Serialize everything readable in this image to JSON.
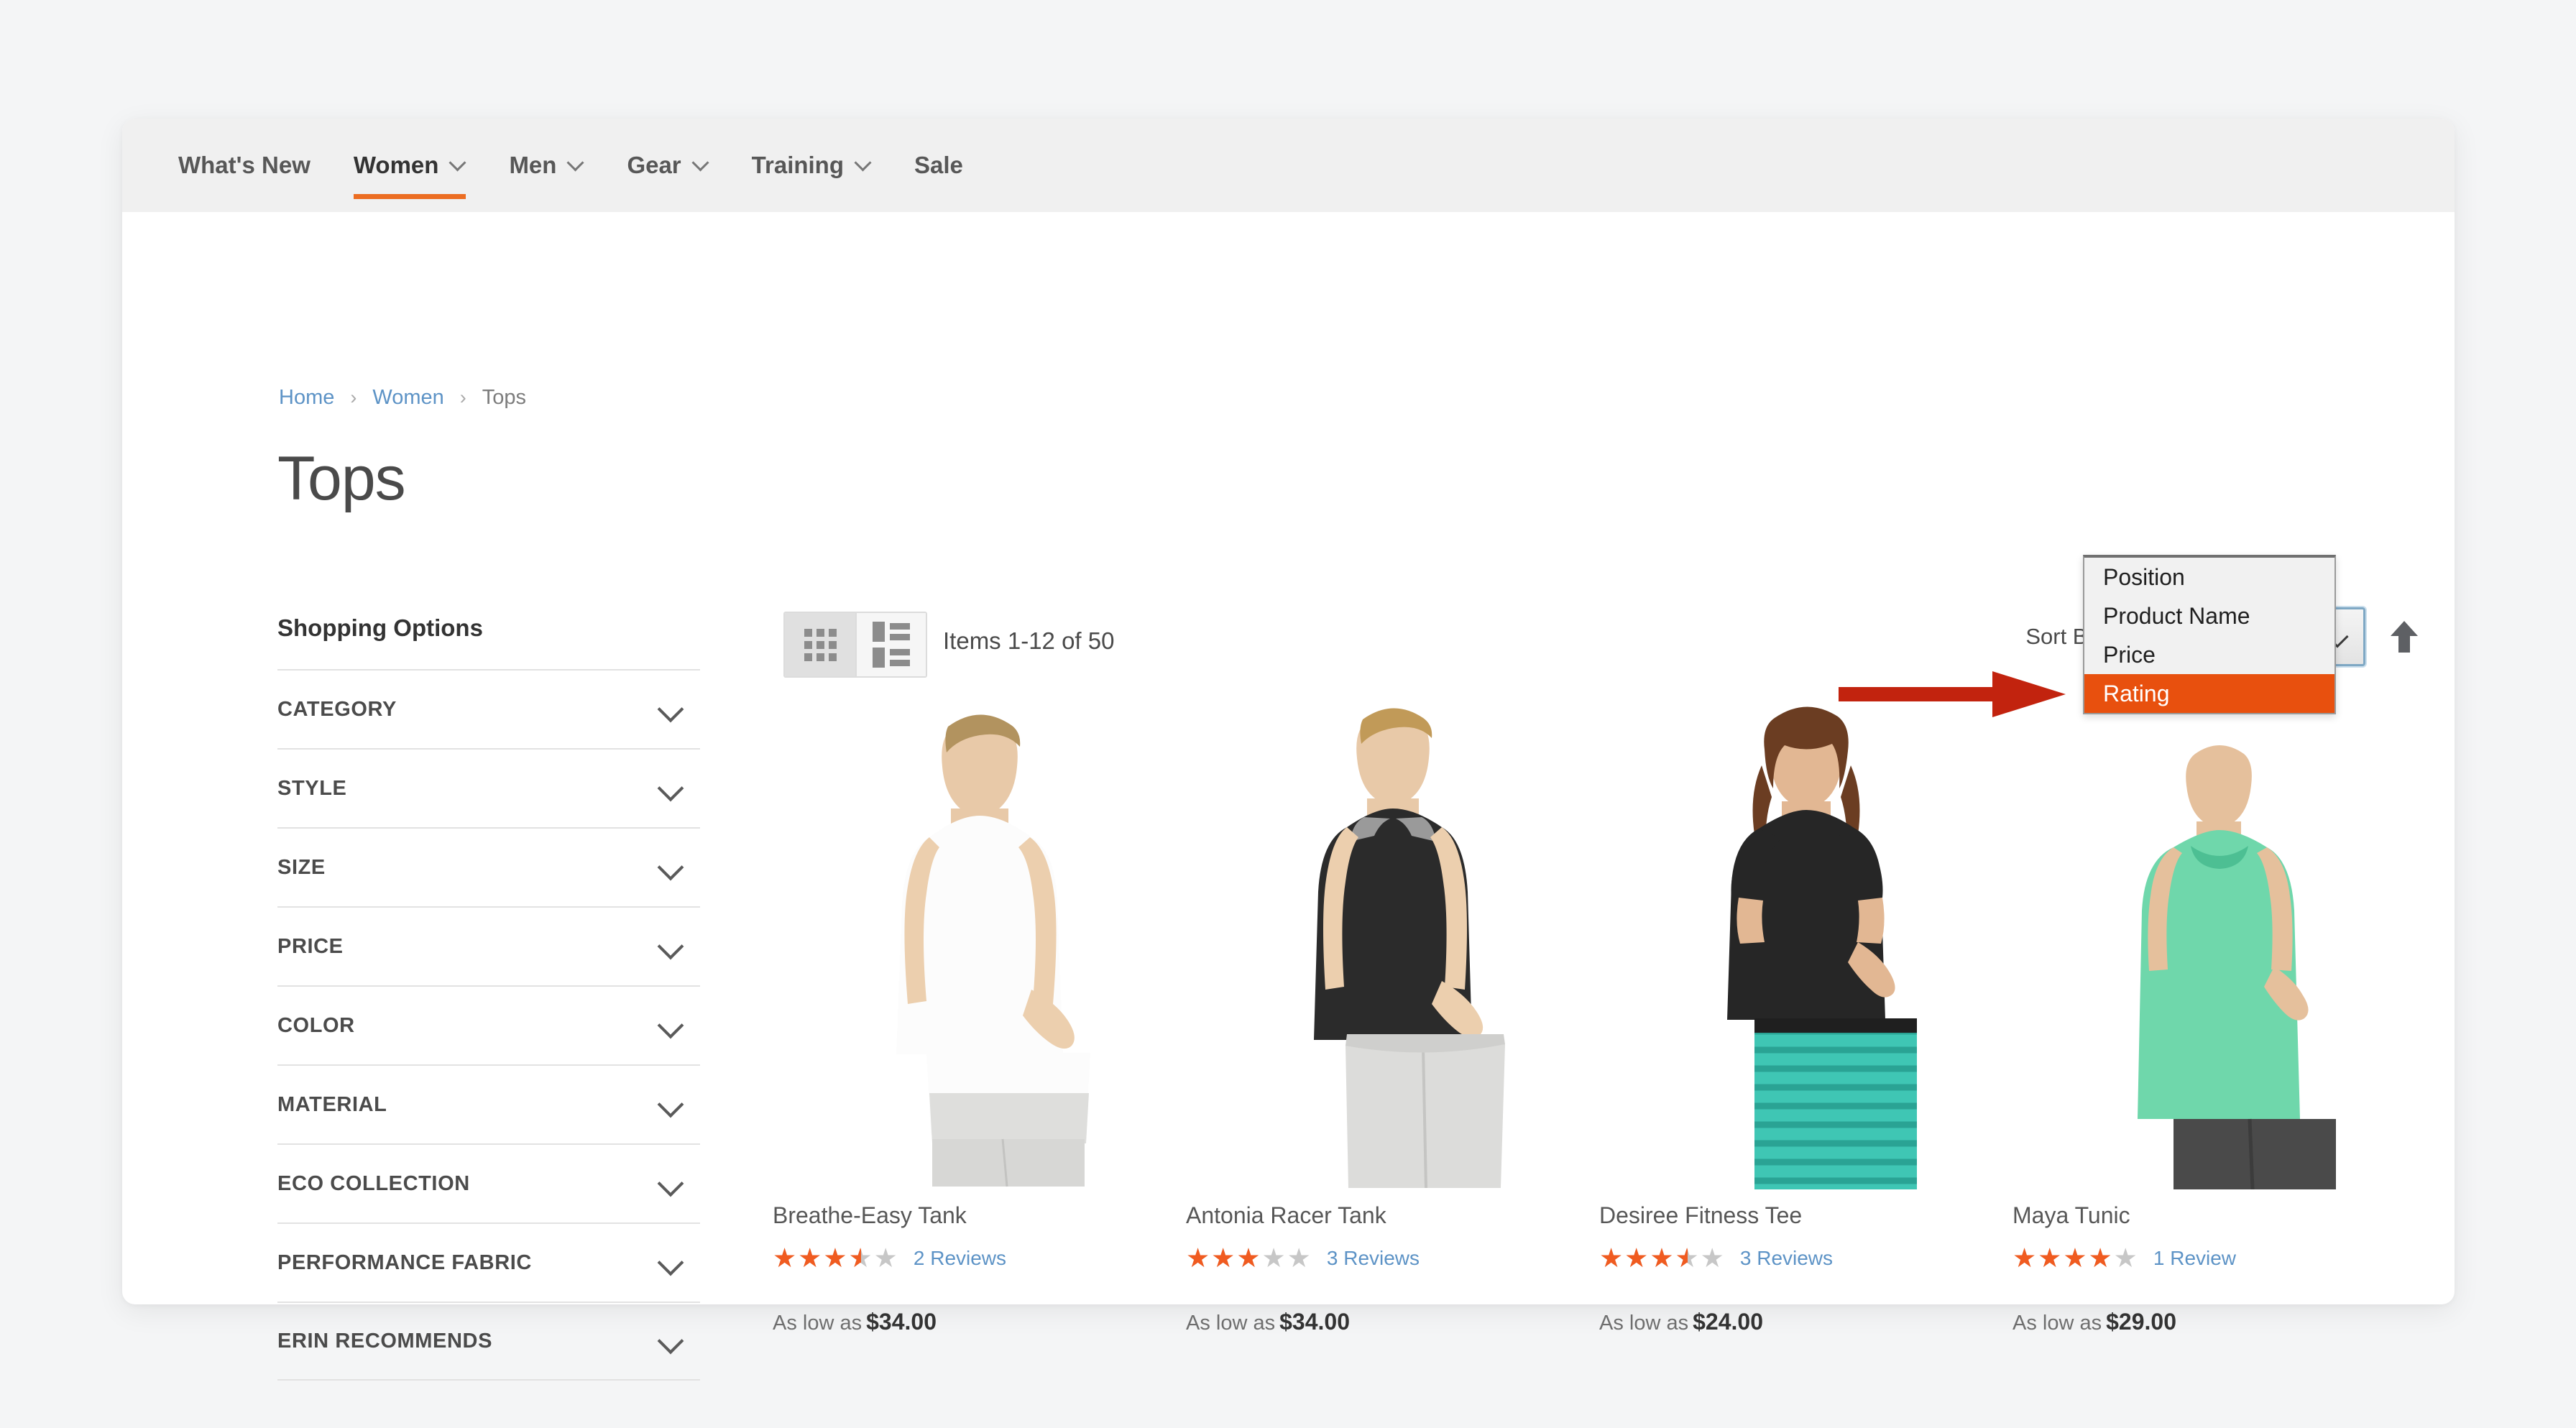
{
  "nav": {
    "items": [
      {
        "label": "What's New",
        "has_caret": false,
        "active": false
      },
      {
        "label": "Women",
        "has_caret": true,
        "active": true
      },
      {
        "label": "Men",
        "has_caret": true,
        "active": false
      },
      {
        "label": "Gear",
        "has_caret": true,
        "active": false
      },
      {
        "label": "Training",
        "has_caret": true,
        "active": false
      },
      {
        "label": "Sale",
        "has_caret": false,
        "active": false
      }
    ]
  },
  "breadcrumb": {
    "home": "Home",
    "parent": "Women",
    "current": "Tops",
    "separator": "›"
  },
  "page": {
    "title": "Tops"
  },
  "sidebar": {
    "title": "Shopping Options",
    "filters": [
      {
        "label": "CATEGORY"
      },
      {
        "label": "STYLE"
      },
      {
        "label": "SIZE"
      },
      {
        "label": "PRICE"
      },
      {
        "label": "COLOR"
      },
      {
        "label": "MATERIAL"
      },
      {
        "label": "ECO COLLECTION"
      },
      {
        "label": "PERFORMANCE FABRIC"
      },
      {
        "label": "ERIN RECOMMENDS"
      }
    ]
  },
  "toolbar": {
    "view_modes": [
      {
        "name": "grid",
        "active": true
      },
      {
        "name": "list",
        "active": false
      }
    ],
    "items_count": "Items 1-12 of 50",
    "sort_label": "Sort By",
    "sort_selected": "Position",
    "sort_options": [
      {
        "label": "Position",
        "highlighted": false
      },
      {
        "label": "Product Name",
        "highlighted": false
      },
      {
        "label": "Price",
        "highlighted": false
      },
      {
        "label": "Rating",
        "highlighted": true
      }
    ],
    "sort_direction_icon": "arrow-up-icon"
  },
  "annotation": {
    "arrow_color": "#c2230e",
    "points_to": "Rating"
  },
  "colors": {
    "accent_orange": "#ec6d22",
    "highlight_orange": "#e8500e",
    "link_blue": "#5d93c6",
    "star_orange": "#f05b20",
    "star_empty": "#c7c7c7",
    "page_bg": "#f4f5f6"
  },
  "products": [
    {
      "name": "Breathe-Easy Tank",
      "rating_percent": 70,
      "review_count": "2",
      "review_label": "Reviews",
      "price_prefix": "As low as",
      "price": "$34.00"
    },
    {
      "name": "Antonia Racer Tank",
      "rating_percent": 60,
      "review_count": "3",
      "review_label": "Reviews",
      "price_prefix": "As low as",
      "price": "$34.00"
    },
    {
      "name": "Desiree Fitness Tee",
      "rating_percent": 70,
      "review_count": "3",
      "review_label": "Reviews",
      "price_prefix": "As low as",
      "price": "$24.00"
    },
    {
      "name": "Maya Tunic",
      "rating_percent": 80,
      "review_count": "1",
      "review_label": "Review",
      "price_prefix": "As low as",
      "price": "$29.00"
    }
  ]
}
